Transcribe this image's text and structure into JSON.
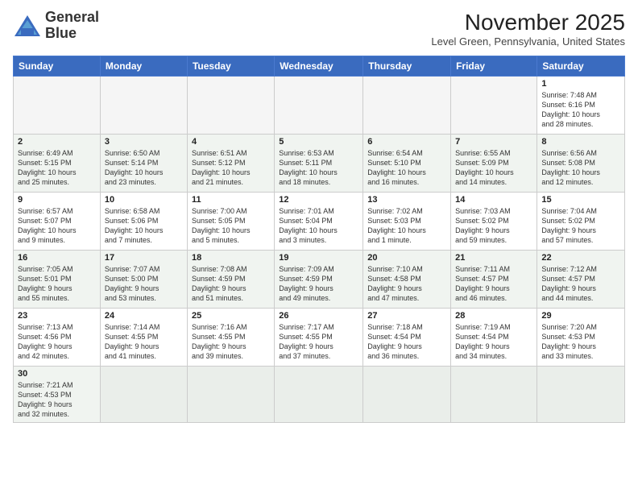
{
  "logo": {
    "line1": "General",
    "line2": "Blue"
  },
  "title": "November 2025",
  "location": "Level Green, Pennsylvania, United States",
  "weekdays": [
    "Sunday",
    "Monday",
    "Tuesday",
    "Wednesday",
    "Thursday",
    "Friday",
    "Saturday"
  ],
  "weeks": [
    [
      {
        "day": "",
        "info": ""
      },
      {
        "day": "",
        "info": ""
      },
      {
        "day": "",
        "info": ""
      },
      {
        "day": "",
        "info": ""
      },
      {
        "day": "",
        "info": ""
      },
      {
        "day": "",
        "info": ""
      },
      {
        "day": "1",
        "info": "Sunrise: 7:48 AM\nSunset: 6:16 PM\nDaylight: 10 hours\nand 28 minutes."
      }
    ],
    [
      {
        "day": "2",
        "info": "Sunrise: 6:49 AM\nSunset: 5:15 PM\nDaylight: 10 hours\nand 25 minutes."
      },
      {
        "day": "3",
        "info": "Sunrise: 6:50 AM\nSunset: 5:14 PM\nDaylight: 10 hours\nand 23 minutes."
      },
      {
        "day": "4",
        "info": "Sunrise: 6:51 AM\nSunset: 5:12 PM\nDaylight: 10 hours\nand 21 minutes."
      },
      {
        "day": "5",
        "info": "Sunrise: 6:53 AM\nSunset: 5:11 PM\nDaylight: 10 hours\nand 18 minutes."
      },
      {
        "day": "6",
        "info": "Sunrise: 6:54 AM\nSunset: 5:10 PM\nDaylight: 10 hours\nand 16 minutes."
      },
      {
        "day": "7",
        "info": "Sunrise: 6:55 AM\nSunset: 5:09 PM\nDaylight: 10 hours\nand 14 minutes."
      },
      {
        "day": "8",
        "info": "Sunrise: 6:56 AM\nSunset: 5:08 PM\nDaylight: 10 hours\nand 12 minutes."
      }
    ],
    [
      {
        "day": "9",
        "info": "Sunrise: 6:57 AM\nSunset: 5:07 PM\nDaylight: 10 hours\nand 9 minutes."
      },
      {
        "day": "10",
        "info": "Sunrise: 6:58 AM\nSunset: 5:06 PM\nDaylight: 10 hours\nand 7 minutes."
      },
      {
        "day": "11",
        "info": "Sunrise: 7:00 AM\nSunset: 5:05 PM\nDaylight: 10 hours\nand 5 minutes."
      },
      {
        "day": "12",
        "info": "Sunrise: 7:01 AM\nSunset: 5:04 PM\nDaylight: 10 hours\nand 3 minutes."
      },
      {
        "day": "13",
        "info": "Sunrise: 7:02 AM\nSunset: 5:03 PM\nDaylight: 10 hours\nand 1 minute."
      },
      {
        "day": "14",
        "info": "Sunrise: 7:03 AM\nSunset: 5:02 PM\nDaylight: 9 hours\nand 59 minutes."
      },
      {
        "day": "15",
        "info": "Sunrise: 7:04 AM\nSunset: 5:02 PM\nDaylight: 9 hours\nand 57 minutes."
      }
    ],
    [
      {
        "day": "16",
        "info": "Sunrise: 7:05 AM\nSunset: 5:01 PM\nDaylight: 9 hours\nand 55 minutes."
      },
      {
        "day": "17",
        "info": "Sunrise: 7:07 AM\nSunset: 5:00 PM\nDaylight: 9 hours\nand 53 minutes."
      },
      {
        "day": "18",
        "info": "Sunrise: 7:08 AM\nSunset: 4:59 PM\nDaylight: 9 hours\nand 51 minutes."
      },
      {
        "day": "19",
        "info": "Sunrise: 7:09 AM\nSunset: 4:59 PM\nDaylight: 9 hours\nand 49 minutes."
      },
      {
        "day": "20",
        "info": "Sunrise: 7:10 AM\nSunset: 4:58 PM\nDaylight: 9 hours\nand 47 minutes."
      },
      {
        "day": "21",
        "info": "Sunrise: 7:11 AM\nSunset: 4:57 PM\nDaylight: 9 hours\nand 46 minutes."
      },
      {
        "day": "22",
        "info": "Sunrise: 7:12 AM\nSunset: 4:57 PM\nDaylight: 9 hours\nand 44 minutes."
      }
    ],
    [
      {
        "day": "23",
        "info": "Sunrise: 7:13 AM\nSunset: 4:56 PM\nDaylight: 9 hours\nand 42 minutes."
      },
      {
        "day": "24",
        "info": "Sunrise: 7:14 AM\nSunset: 4:55 PM\nDaylight: 9 hours\nand 41 minutes."
      },
      {
        "day": "25",
        "info": "Sunrise: 7:16 AM\nSunset: 4:55 PM\nDaylight: 9 hours\nand 39 minutes."
      },
      {
        "day": "26",
        "info": "Sunrise: 7:17 AM\nSunset: 4:55 PM\nDaylight: 9 hours\nand 37 minutes."
      },
      {
        "day": "27",
        "info": "Sunrise: 7:18 AM\nSunset: 4:54 PM\nDaylight: 9 hours\nand 36 minutes."
      },
      {
        "day": "28",
        "info": "Sunrise: 7:19 AM\nSunset: 4:54 PM\nDaylight: 9 hours\nand 34 minutes."
      },
      {
        "day": "29",
        "info": "Sunrise: 7:20 AM\nSunset: 4:53 PM\nDaylight: 9 hours\nand 33 minutes."
      }
    ],
    [
      {
        "day": "30",
        "info": "Sunrise: 7:21 AM\nSunset: 4:53 PM\nDaylight: 9 hours\nand 32 minutes."
      },
      {
        "day": "",
        "info": ""
      },
      {
        "day": "",
        "info": ""
      },
      {
        "day": "",
        "info": ""
      },
      {
        "day": "",
        "info": ""
      },
      {
        "day": "",
        "info": ""
      },
      {
        "day": "",
        "info": ""
      }
    ]
  ]
}
